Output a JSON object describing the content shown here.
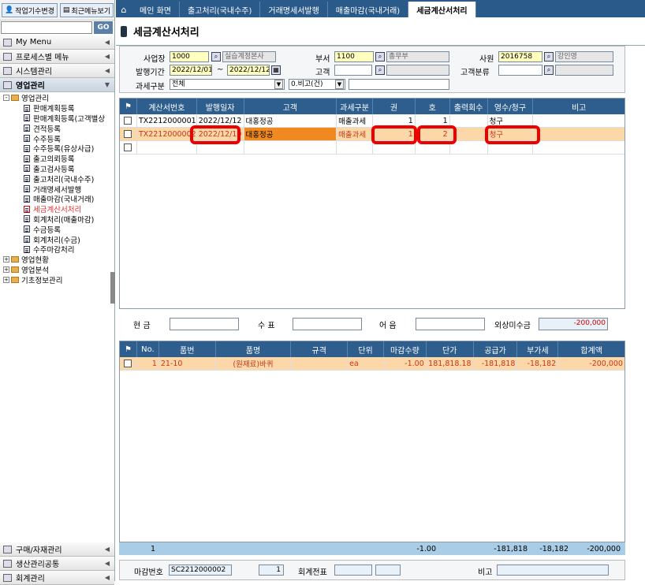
{
  "sidebar": {
    "btn_work": "작업기수변경",
    "btn_recent": "최근메뉴보기",
    "go": "GO",
    "menus": [
      "My Menu",
      "프로세스별 메뉴",
      "시스템관리",
      "영업관리"
    ],
    "tree": [
      {
        "label": "영업관리",
        "type": "folder",
        "level": 0,
        "pm": "-"
      },
      {
        "label": "판매계획등록",
        "type": "doc",
        "level": 1
      },
      {
        "label": "판매계획등록(고객별상",
        "type": "doc",
        "level": 1
      },
      {
        "label": "견적등록",
        "type": "doc",
        "level": 1
      },
      {
        "label": "수주등록",
        "type": "doc",
        "level": 1
      },
      {
        "label": "수주등록(유상사급)",
        "type": "doc",
        "level": 1
      },
      {
        "label": "출고의뢰등록",
        "type": "doc",
        "level": 1
      },
      {
        "label": "출고검사등록",
        "type": "doc",
        "level": 1
      },
      {
        "label": "출고처리(국내수주)",
        "type": "doc",
        "level": 1
      },
      {
        "label": "거래명세서발행",
        "type": "doc",
        "level": 1
      },
      {
        "label": "매출마감(국내거래)",
        "type": "doc",
        "level": 1
      },
      {
        "label": "세금계산서처리",
        "type": "doc",
        "level": 1,
        "selected": true
      },
      {
        "label": "회계처리(매출마감)",
        "type": "doc",
        "level": 1
      },
      {
        "label": "수금등록",
        "type": "doc",
        "level": 1
      },
      {
        "label": "회계처리(수금)",
        "type": "doc",
        "level": 1
      },
      {
        "label": "수주마감처리",
        "type": "doc",
        "level": 1
      },
      {
        "label": "영업현황",
        "type": "folder",
        "level": 0,
        "pm": "+"
      },
      {
        "label": "영업분석",
        "type": "folder",
        "level": 0,
        "pm": "+"
      },
      {
        "label": "기초정보관리",
        "type": "folder",
        "level": 0,
        "pm": "+"
      }
    ],
    "bottom_menus": [
      "구매/자재관리",
      "생산관리공통",
      "회계관리"
    ]
  },
  "tabs": [
    "메인 화면",
    "출고처리(국내수주)",
    "거래명세서발행",
    "매출마감(국내거래)",
    "세금계산서처리"
  ],
  "title": "세금계산서처리",
  "filter": {
    "biz_label": "사업장",
    "biz_code": "1000",
    "biz_name": "실습계정본사",
    "dept_label": "부서",
    "dept_code": "1100",
    "dept_name": "총무부",
    "emp_label": "사원",
    "emp_code": "2016758",
    "emp_name": "강인영",
    "period_label": "발행기간",
    "date_from": "2022/12/01",
    "tilde": "~",
    "date_to": "2022/12/12",
    "cust_label": "고객",
    "cust_class_label": "고객분류",
    "tax_label": "과세구분",
    "tax_value": "전체",
    "remark_value": "0.비고(건)"
  },
  "top_grid": {
    "headers": [
      "계산서번호",
      "발행일자",
      "고객",
      "과세구분",
      "권",
      "호",
      "출력회수",
      "영수/청구",
      "비고"
    ],
    "rows": [
      {
        "no": "TX2212000001",
        "date": "2022/12/12",
        "cust": "대홍정공",
        "tax": "매출과세",
        "kwon": "1",
        "ho": "1",
        "print": "",
        "claim": "청구",
        "remark": ""
      },
      {
        "no": "TX2212000002",
        "date": "2022/12/10",
        "cust": "대홍정공",
        "tax": "매출과세",
        "kwon": "1",
        "ho": "2",
        "print": "",
        "claim": "청구",
        "remark": ""
      }
    ]
  },
  "pay": {
    "cash": "현   금",
    "check": "수   표",
    "bill": "어   음",
    "receivable": "외상미수금",
    "receivable_value": "-200,000"
  },
  "bottom_grid": {
    "headers": [
      "No.",
      "품번",
      "품명",
      "규격",
      "단위",
      "마감수량",
      "단가",
      "공급가",
      "부가세",
      "합계액"
    ],
    "rows": [
      {
        "no": "1",
        "code": "21-10",
        "name": "(원재료)바퀴",
        "spec": "",
        "unit": "ea",
        "qty": "-1.00",
        "price": "181,818.18",
        "supply": "-181,818",
        "vat": "-18,182",
        "total": "-200,000"
      }
    ]
  },
  "footer": {
    "count": "1",
    "qty": "-1.00",
    "supply": "-181,818",
    "vat": "-18,182",
    "total": "-200,000"
  },
  "bottombar": {
    "close_label": "마감번호",
    "close_no": "SC2212000002",
    "close_seq": "1",
    "journal_label": "회계전표",
    "remark_label": "비고"
  }
}
